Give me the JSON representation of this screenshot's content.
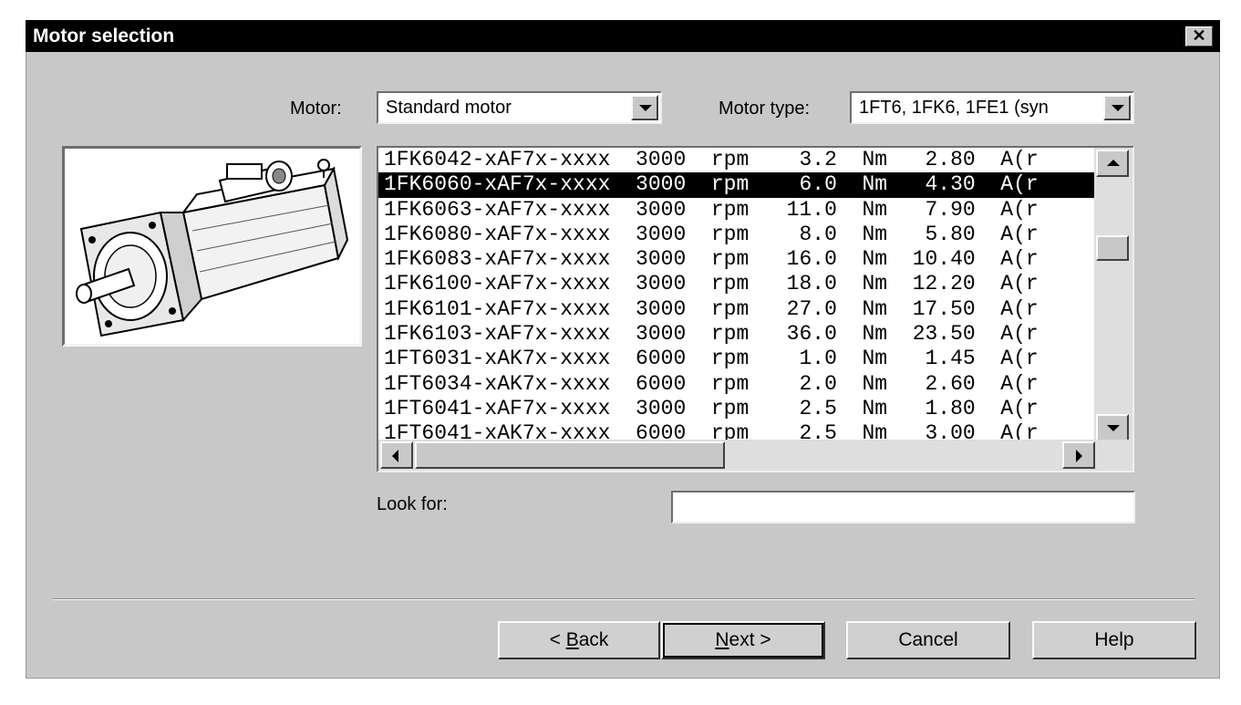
{
  "window": {
    "title": "Motor selection"
  },
  "motor": {
    "label": "Motor:",
    "value": "Standard motor"
  },
  "motor_type": {
    "label": "Motor type:",
    "value": "1FT6, 1FK6, 1FE1 (syn"
  },
  "motor_list": {
    "selected_index": 1,
    "rows": [
      "1FK6042-xAF7x-xxxx  3000  rpm    3.2  Nm   2.80  A(r",
      "1FK6060-xAF7x-xxxx  3000  rpm    6.0  Nm   4.30  A(r",
      "1FK6063-xAF7x-xxxx  3000  rpm   11.0  Nm   7.90  A(r",
      "1FK6080-xAF7x-xxxx  3000  rpm    8.0  Nm   5.80  A(r",
      "1FK6083-xAF7x-xxxx  3000  rpm   16.0  Nm  10.40  A(r",
      "1FK6100-xAF7x-xxxx  3000  rpm   18.0  Nm  12.20  A(r",
      "1FK6101-xAF7x-xxxx  3000  rpm   27.0  Nm  17.50  A(r",
      "1FK6103-xAF7x-xxxx  3000  rpm   36.0  Nm  23.50  A(r",
      "1FT6031-xAK7x-xxxx  6000  rpm    1.0  Nm   1.45  A(r",
      "1FT6034-xAK7x-xxxx  6000  rpm    2.0  Nm   2.60  A(r",
      "1FT6041-xAF7x-xxxx  3000  rpm    2.5  Nm   1.80  A(r",
      "1FT6041-xAK7x-xxxx  6000  rpm    2.5  Nm   3.00  A(r"
    ]
  },
  "search": {
    "label": "Look for:",
    "value": ""
  },
  "buttons": {
    "back": {
      "prefix": "< ",
      "mnemonic": "B",
      "rest": "ack"
    },
    "next": {
      "mnemonic": "N",
      "rest": "ext >"
    },
    "cancel": "Cancel",
    "help": "Help"
  },
  "icons": {
    "close": "close-icon",
    "picture": "servo-motor-picture"
  }
}
